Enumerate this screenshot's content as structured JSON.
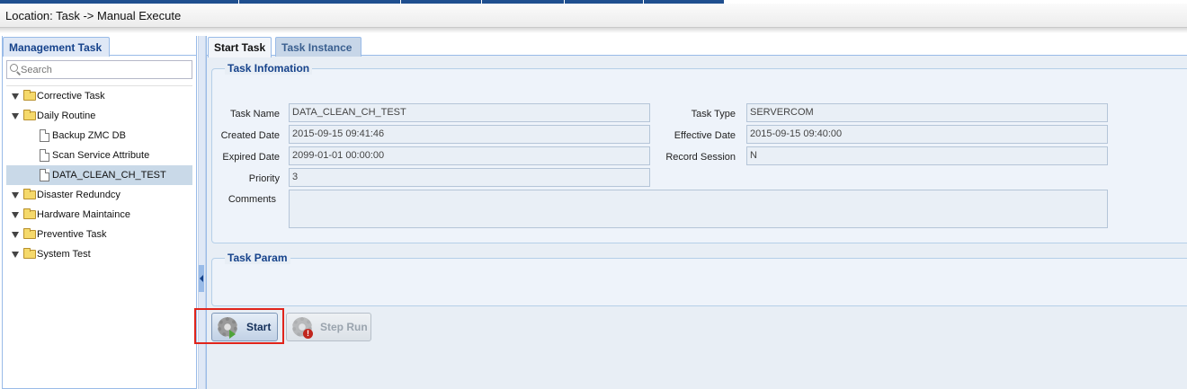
{
  "location": "Location: Task -> Manual Execute",
  "left_panel": {
    "tab_label": "Management Task",
    "search_placeholder": "Search",
    "tree": [
      {
        "label": "Corrective Task",
        "type": "folder"
      },
      {
        "label": "Daily Routine",
        "type": "folder",
        "children": [
          {
            "label": "Backup ZMC DB",
            "type": "file"
          },
          {
            "label": "Scan Service Attribute",
            "type": "file"
          },
          {
            "label": "DATA_CLEAN_CH_TEST",
            "type": "file",
            "selected": true
          }
        ]
      },
      {
        "label": "Disaster Redundcy",
        "type": "folder"
      },
      {
        "label": "Hardware Maintaince",
        "type": "folder"
      },
      {
        "label": "Preventive Task",
        "type": "folder"
      },
      {
        "label": "System Test",
        "type": "folder"
      }
    ]
  },
  "tabs": {
    "start_task": "Start Task",
    "task_instance": "Task Instance"
  },
  "task_info": {
    "legend": "Task Infomation",
    "task_name_label": "Task Name",
    "task_name": "DATA_CLEAN_CH_TEST",
    "created_date_label": "Created Date",
    "created_date": "2015-09-15 09:41:46",
    "expired_date_label": "Expired Date",
    "expired_date": "2099-01-01 00:00:00",
    "priority_label": "Priority",
    "priority": "3",
    "comments_label": "Comments",
    "comments": "",
    "task_type_label": "Task Type",
    "task_type": "SERVERCOM",
    "effective_date_label": "Effective Date",
    "effective_date": "2015-09-15 09:40:00",
    "record_session_label": "Record Session",
    "record_session": "N"
  },
  "task_param": {
    "legend": "Task Param"
  },
  "buttons": {
    "start": "Start",
    "step_run": "Step Run"
  },
  "colors": {
    "accent": "#15428b",
    "panel_border": "#99bbe8",
    "highlight": "#e0241b"
  }
}
